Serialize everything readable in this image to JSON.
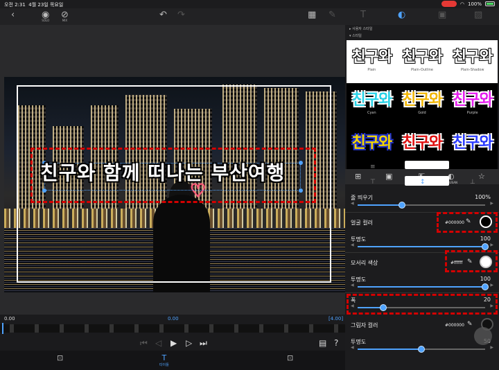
{
  "status": {
    "time": "오전 2:31",
    "date": "4월 23일 목요일",
    "battery": "100%"
  },
  "toolbar": {
    "back_icon": "chevron-left-icon",
    "solo_label": "SOLO",
    "mute_label": "MIX"
  },
  "canvas": {
    "title_text": "친구와 함께 떠나는 부산여행"
  },
  "timeline": {
    "start": "0.00",
    "current": "0.00",
    "end": "[4.00]"
  },
  "tabs": {
    "title": "타이틀"
  },
  "panel": {
    "user_styles_label": "사용자 스타일",
    "styles_label": "스타일",
    "styles": [
      {
        "sample": "친구와",
        "name": "Plain",
        "color": "#ffffff",
        "stroke": "#000000"
      },
      {
        "sample": "친구와",
        "name": "Plain-Outline",
        "color": "#ffffff",
        "stroke": "#000000"
      },
      {
        "sample": "친구와",
        "name": "Plain-Shadow",
        "color": "#ffffff",
        "stroke": "#000000"
      },
      {
        "sample": "친구와",
        "name": "Cyan",
        "color": "#29d3e8",
        "stroke": "#ffffff"
      },
      {
        "sample": "친구와",
        "name": "Gold",
        "color": "#f2b705",
        "stroke": "#ffffff"
      },
      {
        "sample": "친구와",
        "name": "Purple",
        "color": "#e61cf0",
        "stroke": "#ffffff"
      },
      {
        "sample": "친구와",
        "name": "",
        "color": "#f5d700",
        "stroke": "#2233cc"
      },
      {
        "sample": "친구와",
        "name": "",
        "color": "#e01010",
        "stroke": "#ffffff"
      },
      {
        "sample": "친구와",
        "name": "",
        "color": "#2a3bff",
        "stroke": "#ffffff"
      }
    ],
    "style_tools_caption": "BUSAN",
    "line_spacing_label": "줄 띄우기",
    "line_spacing_value": "100%",
    "line_spacing": 0.35,
    "face_color_label": "얼굴 컬러",
    "face_color_hex": "#000000",
    "opacity1_label": "투명도",
    "opacity1_value": "100",
    "opacity1": 1.0,
    "outline_color_label": "모서리 색상",
    "outline_color_hex": "#ffffff",
    "opacity2_label": "투명도",
    "opacity2_value": "100",
    "opacity2": 1.0,
    "width_label": "폭",
    "width_value": "20",
    "width": 0.2,
    "shadow_color_label": "그림자 컬러",
    "shadow_color_hex": "#000000",
    "opacity3_label": "투명도",
    "opacity3_value": "50",
    "opacity3": 0.5
  }
}
